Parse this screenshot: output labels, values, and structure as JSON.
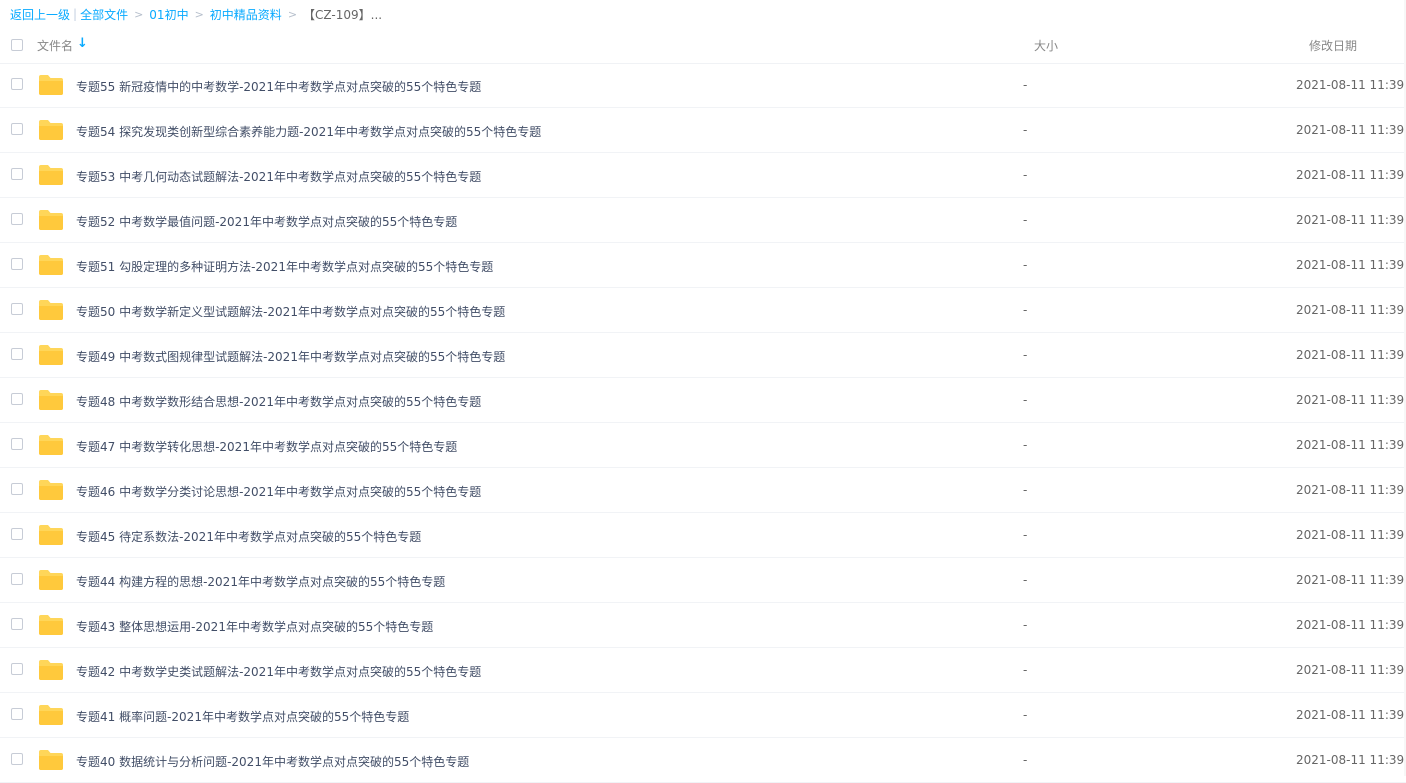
{
  "breadcrumb": {
    "back": "返回上一级",
    "sep": "|",
    "items": [
      "全部文件",
      "01初中",
      "初中精品资料"
    ],
    "arrow": ">",
    "current": "【CZ-109】..."
  },
  "header": {
    "name_label": "文件名",
    "sort_icon": "arrow-down",
    "size_label": "大小",
    "date_label": "修改日期"
  },
  "rows": [
    {
      "name": "专题55 新冠疫情中的中考数学-2021年中考数学点对点突破的55个特色专题",
      "size": "-",
      "date": "2021-08-11 11:39"
    },
    {
      "name": "专题54 探究发现类创新型综合素养能力题-2021年中考数学点对点突破的55个特色专题",
      "size": "-",
      "date": "2021-08-11 11:39"
    },
    {
      "name": "专题53 中考几何动态试题解法-2021年中考数学点对点突破的55个特色专题",
      "size": "-",
      "date": "2021-08-11 11:39"
    },
    {
      "name": "专题52 中考数学最值问题-2021年中考数学点对点突破的55个特色专题",
      "size": "-",
      "date": "2021-08-11 11:39"
    },
    {
      "name": "专题51 勾股定理的多种证明方法-2021年中考数学点对点突破的55个特色专题",
      "size": "-",
      "date": "2021-08-11 11:39"
    },
    {
      "name": "专题50 中考数学新定义型试题解法-2021年中考数学点对点突破的55个特色专题",
      "size": "-",
      "date": "2021-08-11 11:39"
    },
    {
      "name": "专题49 中考数式图规律型试题解法-2021年中考数学点对点突破的55个特色专题",
      "size": "-",
      "date": "2021-08-11 11:39"
    },
    {
      "name": "专题48 中考数学数形结合思想-2021年中考数学点对点突破的55个特色专题",
      "size": "-",
      "date": "2021-08-11 11:39"
    },
    {
      "name": "专题47 中考数学转化思想-2021年中考数学点对点突破的55个特色专题",
      "size": "-",
      "date": "2021-08-11 11:39"
    },
    {
      "name": "专题46 中考数学分类讨论思想-2021年中考数学点对点突破的55个特色专题",
      "size": "-",
      "date": "2021-08-11 11:39"
    },
    {
      "name": "专题45 待定系数法-2021年中考数学点对点突破的55个特色专题",
      "size": "-",
      "date": "2021-08-11 11:39"
    },
    {
      "name": "专题44 构建方程的思想-2021年中考数学点对点突破的55个特色专题",
      "size": "-",
      "date": "2021-08-11 11:39"
    },
    {
      "name": "专题43 整体思想运用-2021年中考数学点对点突破的55个特色专题",
      "size": "-",
      "date": "2021-08-11 11:39"
    },
    {
      "name": "专题42 中考数学史类试题解法-2021年中考数学点对点突破的55个特色专题",
      "size": "-",
      "date": "2021-08-11 11:39"
    },
    {
      "name": "专题41 概率问题-2021年中考数学点对点突破的55个特色专题",
      "size": "-",
      "date": "2021-08-11 11:39"
    },
    {
      "name": "专题40 数据统计与分析问题-2021年中考数学点对点突破的55个特色专题",
      "size": "-",
      "date": "2021-08-11 11:39"
    }
  ],
  "colors": {
    "link": "#09aaff",
    "folder": "#ffd659",
    "text": "#424e67"
  }
}
